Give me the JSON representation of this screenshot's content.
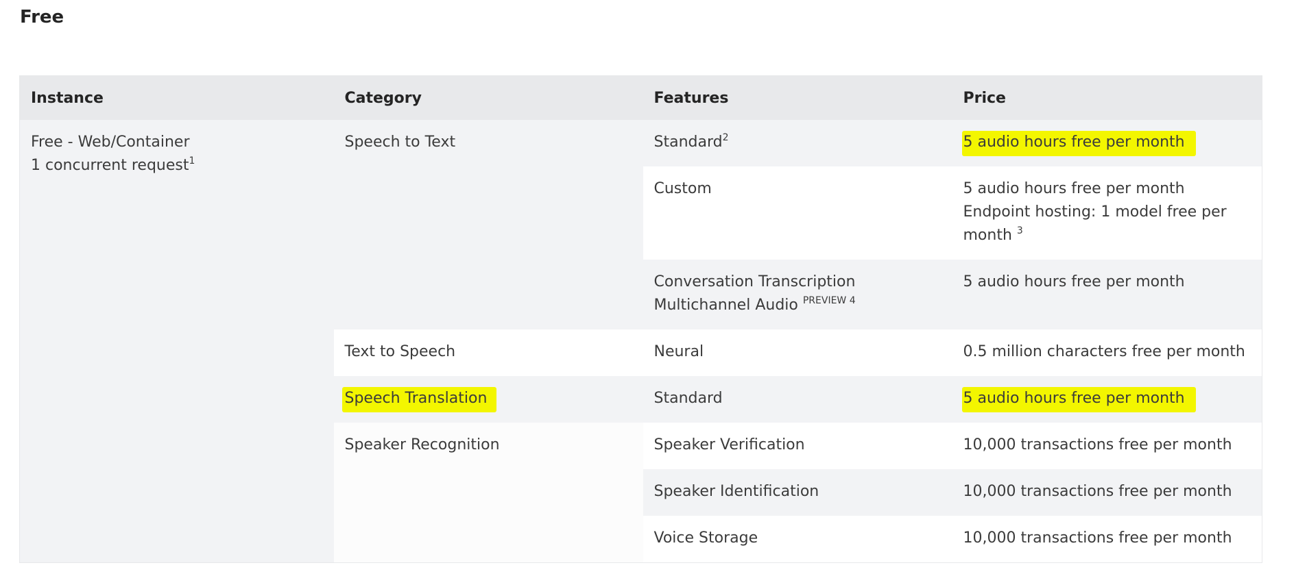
{
  "page": {
    "heading": "Free"
  },
  "table": {
    "headers": [
      "Instance",
      "Category",
      "Features",
      "Price"
    ],
    "instance": {
      "line1": "Free - Web/Container",
      "line2": "1 concurrent request",
      "line2_sup": "1"
    },
    "categories": {
      "speech_to_text": "Speech to Text",
      "text_to_speech": "Text to Speech",
      "speech_translation": "Speech Translation",
      "speaker_recognition": "Speaker Recognition"
    },
    "rows": {
      "stt_standard": {
        "feature": "Standard",
        "feature_sup": "2",
        "price": "5 audio hours free per month",
        "highlighted": true
      },
      "stt_custom": {
        "feature": "Custom",
        "price_line1": "5 audio hours free per month",
        "price_line2": "Endpoint hosting: 1 model free per month",
        "price_sup": "3"
      },
      "stt_conversation": {
        "feature": "Conversation Transcription Multichannel Audio",
        "feature_sup": "PREVIEW 4",
        "price": "5 audio hours free per month"
      },
      "tts_neural": {
        "feature": "Neural",
        "price": "0.5 million characters free per month"
      },
      "translation_standard": {
        "feature": "Standard",
        "price": "5 audio hours free per month",
        "highlighted": true
      },
      "speaker_verification": {
        "feature": "Speaker Verification",
        "price": "10,000 transactions free per month"
      },
      "speaker_identification": {
        "feature": "Speaker Identification",
        "price": "10,000 transactions free per month"
      },
      "voice_storage": {
        "feature": "Voice Storage",
        "price": "10,000 transactions free per month"
      }
    }
  },
  "colors": {
    "highlight": "#f3f600",
    "header_bg": "#e8e9eb",
    "row_shade": "#f2f3f5"
  }
}
